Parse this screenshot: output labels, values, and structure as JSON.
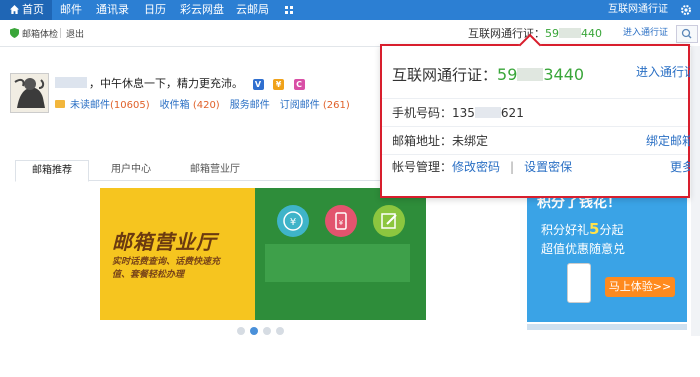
{
  "topnav": {
    "tabs": [
      "首页",
      "邮件",
      "通讯录",
      "日历",
      "彩云网盘",
      "云邮局"
    ],
    "account_label": "互联网通行证"
  },
  "subbar": {
    "checkup": "邮箱体检",
    "logout": "退出",
    "pass_label": "互联网通行证：",
    "pass_num_a": "59",
    "pass_num_b": "440",
    "enter": "进入通行证"
  },
  "profile": {
    "greeting": "，中午休息一下，精力更充沛。",
    "links": {
      "unread_label": "未读邮件",
      "unread_count": "(10605)",
      "inbox_label": "收件箱",
      "inbox_count": "(420)",
      "service_label": "服务邮件",
      "subscribe_label": "订阅邮件",
      "subscribe_count": "(261)"
    }
  },
  "content_tabs": [
    "邮箱推荐",
    "用户中心",
    "邮箱营业厅"
  ],
  "banner": {
    "title": "邮箱营业厅",
    "desc_line1": "实时话费查询、话费快速充",
    "desc_line2": "值、套餐轻松办理"
  },
  "ad": {
    "head": "积分了钱花！",
    "line1_a": "积分好礼",
    "line1_b": "5",
    "line1_c": "分起",
    "line2": "超值优惠随意兑",
    "button": "马上体验>>"
  },
  "popup": {
    "pass_label": "互联网通行证：",
    "pass_num_a": "59",
    "pass_num_b": "3440",
    "enter": "进入通行证",
    "phone_label": "手机号码：",
    "phone_a": "135",
    "phone_b": "621",
    "email_label": "邮箱地址：",
    "email_value": "未绑定",
    "bind": "绑定邮箱",
    "manage_label": "帐号管理：",
    "change_pwd": "修改密码",
    "divider": "|",
    "security": "设置密保",
    "more": "更多"
  },
  "colors": {
    "topbar": "#2c7fd3",
    "popup_border": "#d81e2d",
    "link": "#2a6fc4",
    "accent_green": "#3aa63a"
  }
}
